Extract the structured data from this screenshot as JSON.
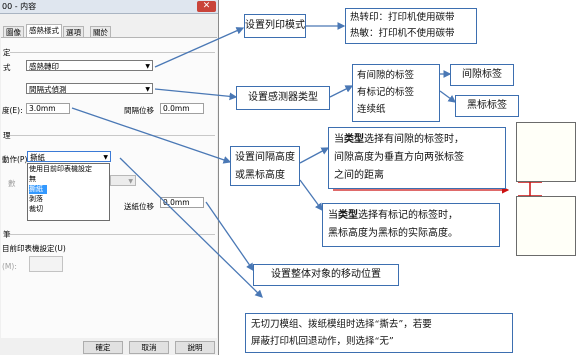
{
  "dialog": {
    "title": "00 - 内容",
    "close_glyph": "✕",
    "tabs": [
      "圖像",
      "感熱樣式",
      "選項",
      "關於"
    ],
    "active_tab": 1,
    "group_label_1": "定",
    "print_mode_label": "式",
    "print_mode_value": "感熱轉印",
    "sensor_type_value": "間隔式偵測",
    "gap_height_label": "度(E):",
    "gap_height_value": "3.0mm",
    "gap_offset_label": "間隔位移",
    "gap_offset_value": "0.0mm",
    "group_label_2": "理",
    "post_action_label": "動作(P):",
    "post_action_value": "撕紙",
    "post_action_options": [
      "使用目前印表機設定",
      "無",
      "撕紙",
      "剥落",
      "裁切"
    ],
    "post_action_selected": 2,
    "hidden_label_1": "數",
    "occurs_label": "",
    "offset_label": "送紙位移",
    "offset_value": "0.0mm",
    "group_label_3": "筆",
    "use_current_label": "目前印表機設定(U)",
    "hidden_label_2": "(M):",
    "ok_label": "確定",
    "cancel_label": "取消",
    "help_label": "說明"
  },
  "callouts": {
    "print_mode": "设置列印模式",
    "thermal_transfer": "热转印：打印机使用碳带",
    "direct_thermal": "热敏：打印机不使用碳带",
    "sensor_type": "设置感测器类型",
    "gap_labels": "有间隙的标签",
    "mark_labels": "有标记的标签",
    "continuous": "连续纸",
    "gap_tag": "间隙标签",
    "mark_tag": "黑标标签",
    "gap_height_l1": "设置间隔高度",
    "gap_height_l2": "或黑标高度",
    "gap_desc_kw": "类型",
    "gap_desc_l1a": "当",
    "gap_desc_l1b": "选择有间隙的标签时，",
    "gap_desc_l2": "间隙高度为垂直方向两张标签",
    "gap_desc_l3": "之间的距离",
    "mark_desc_l1a": "当",
    "mark_desc_l1b": "选择有标记的标签时，",
    "mark_desc_l2": "黑标高度为黑标的实际高度。",
    "position": "设置整体对象的移动位置",
    "tear_l1": "无切刀模组、拨纸模组时选择“撕去”，若要",
    "tear_l2": "屏蔽打印机回退动作，则选择“无”"
  },
  "colors": {
    "arrow": "#4a78b5",
    "callout_border": "#3d6fb0",
    "red_arrow": "#cc1111",
    "highlight": "#3399ff"
  }
}
